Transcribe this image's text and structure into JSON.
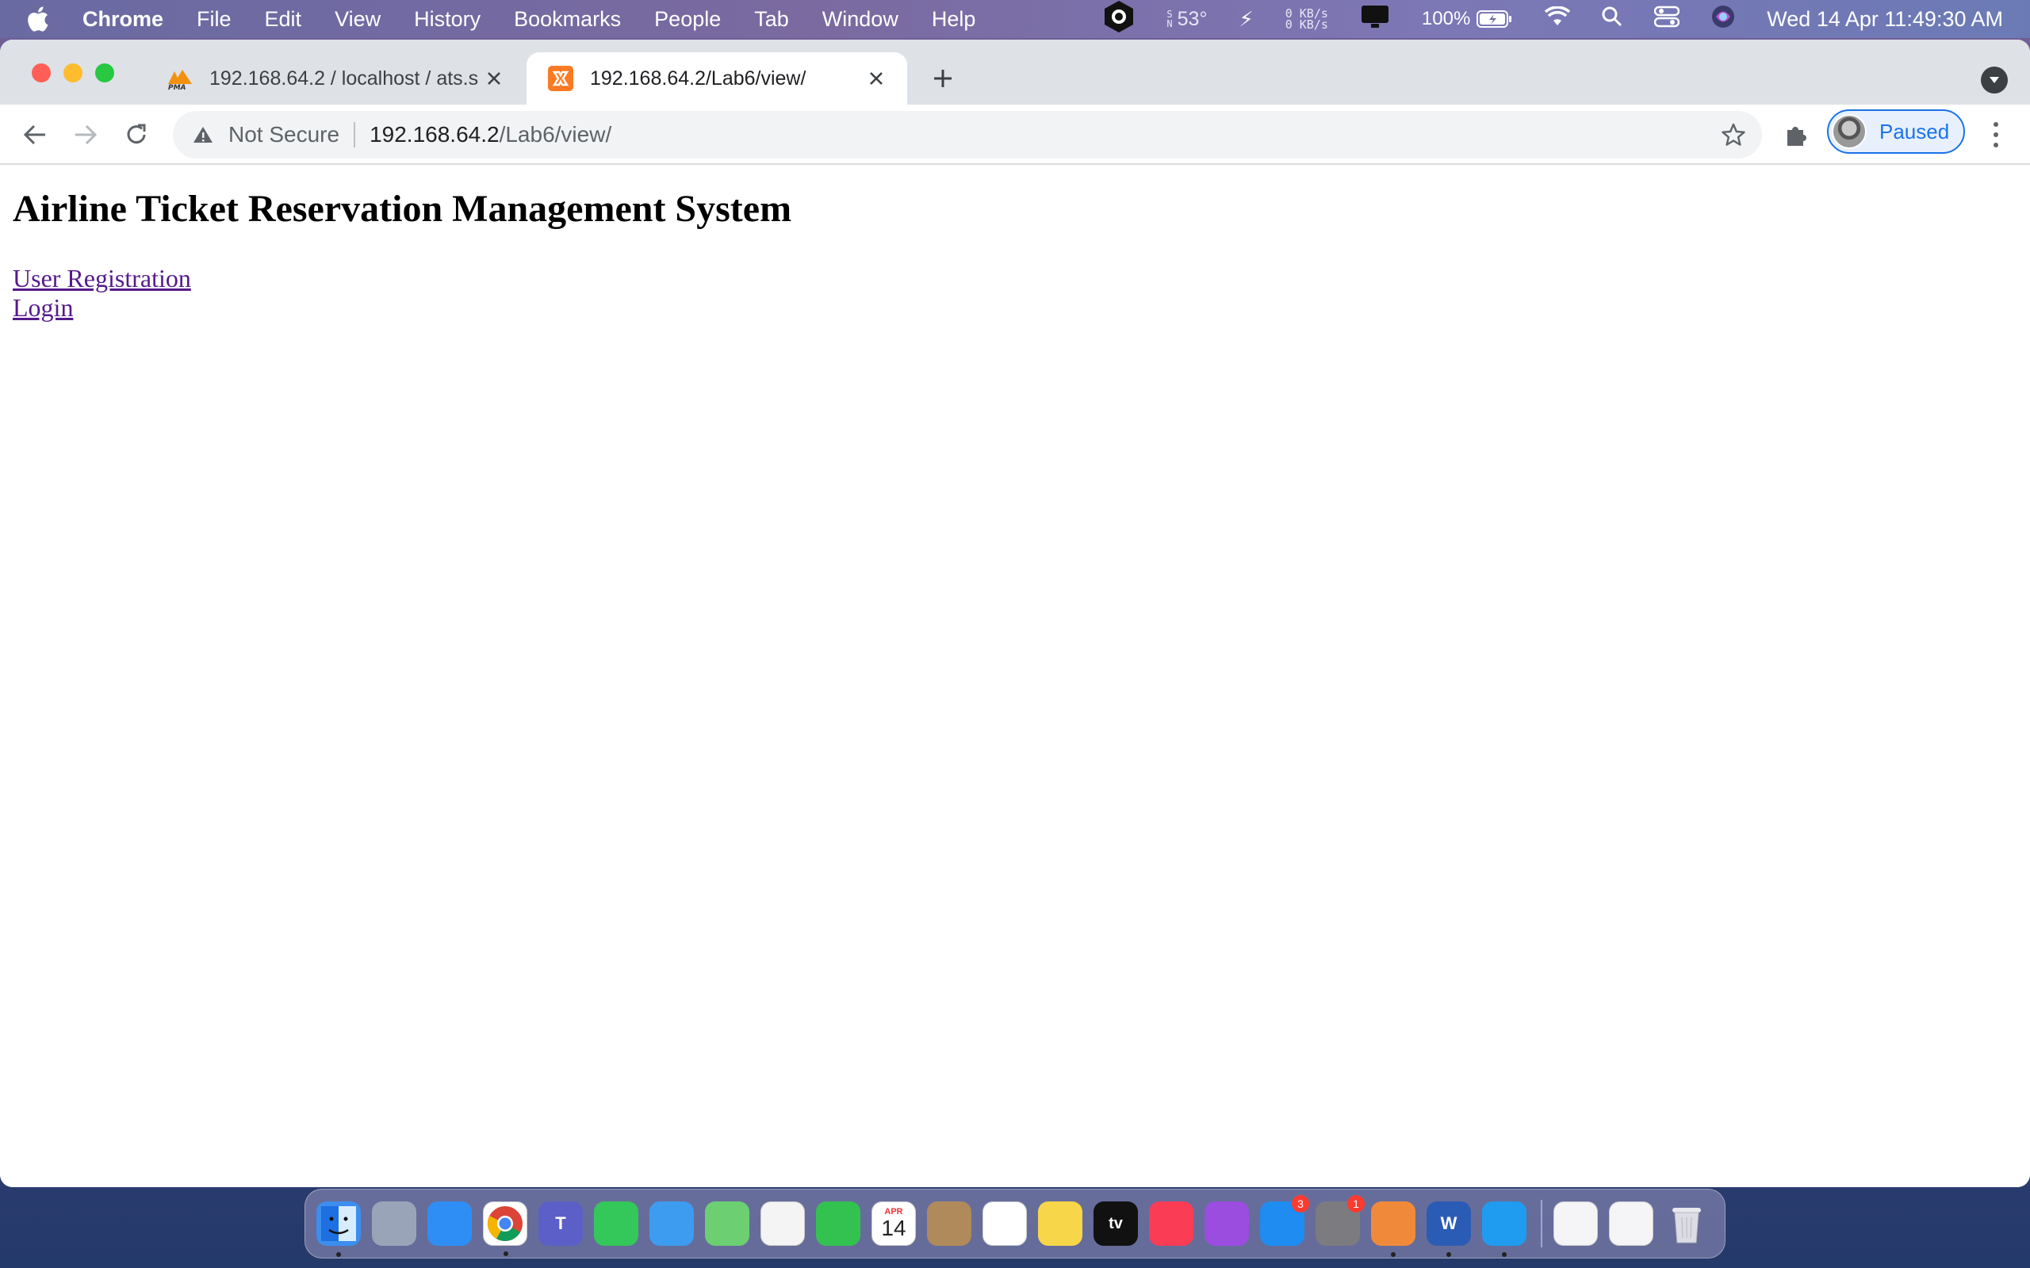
{
  "menubar": {
    "app_name": "Chrome",
    "items": [
      "File",
      "Edit",
      "View",
      "History",
      "Bookmarks",
      "People",
      "Tab",
      "Window",
      "Help"
    ],
    "weather": "53°",
    "network_up": "0 KB/s",
    "network_down": "0 KB/s",
    "battery": "100%",
    "clock": "Wed 14 Apr  11:49:30 AM"
  },
  "browser": {
    "tabs": [
      {
        "title": "192.168.64.2 / localhost / ats.s",
        "icon": "phpmyadmin-icon",
        "active": false
      },
      {
        "title": "192.168.64.2/Lab6/view/",
        "icon": "xampp-icon",
        "active": true
      }
    ],
    "security_label": "Not Secure",
    "url_host": "192.168.64.2",
    "url_path": "/Lab6/view/",
    "profile_label": "Paused",
    "accent": "#1a73e8"
  },
  "page": {
    "heading": "Airline Ticket Reservation Management System",
    "links": [
      "User Registration",
      "Login"
    ],
    "link_color": "#551a8b"
  },
  "dock": {
    "apps": [
      {
        "name": "Finder",
        "color": "#3c8ef0",
        "running": true
      },
      {
        "name": "Launchpad",
        "color": "#9aa4b8",
        "running": false
      },
      {
        "name": "Safari",
        "color": "#2f8ef5",
        "running": false
      },
      {
        "name": "Chrome",
        "color": "#ffffff",
        "running": true
      },
      {
        "name": "Teams",
        "color": "#5b5fc7",
        "running": false
      },
      {
        "name": "Messages",
        "color": "#34c759",
        "running": false
      },
      {
        "name": "Mail",
        "color": "#3d9bf0",
        "running": false
      },
      {
        "name": "Maps",
        "color": "#6ccf72",
        "running": false
      },
      {
        "name": "Photos",
        "color": "#f4f4f4",
        "running": false
      },
      {
        "name": "FaceTime",
        "color": "#33c24f",
        "running": false
      },
      {
        "name": "Calendar",
        "color": "#ffffff",
        "running": false
      },
      {
        "name": "Contacts",
        "color": "#b08a5a",
        "running": false
      },
      {
        "name": "Reminders",
        "color": "#ffffff",
        "running": false
      },
      {
        "name": "Notes",
        "color": "#f7d64a",
        "running": false
      },
      {
        "name": "TV",
        "color": "#111111",
        "running": false
      },
      {
        "name": "Music",
        "color": "#fa3c55",
        "running": false
      },
      {
        "name": "Podcasts",
        "color": "#9b4de0",
        "running": false
      },
      {
        "name": "App Store",
        "color": "#1e8cf0",
        "running": false
      },
      {
        "name": "System Preferences",
        "color": "#7c7c80",
        "running": false
      },
      {
        "name": "XAMPP",
        "color": "#f08a3a",
        "running": true
      },
      {
        "name": "Word",
        "color": "#2b5cb5",
        "running": true
      },
      {
        "name": "VS Code",
        "color": "#1f9cf0",
        "running": true
      }
    ],
    "badges": {
      "App Store": "3",
      "System Preferences": "1"
    },
    "calendar_month": "APR",
    "calendar_day": "14",
    "tv_label": "tv",
    "word_label": "W",
    "teams_label": "T"
  }
}
